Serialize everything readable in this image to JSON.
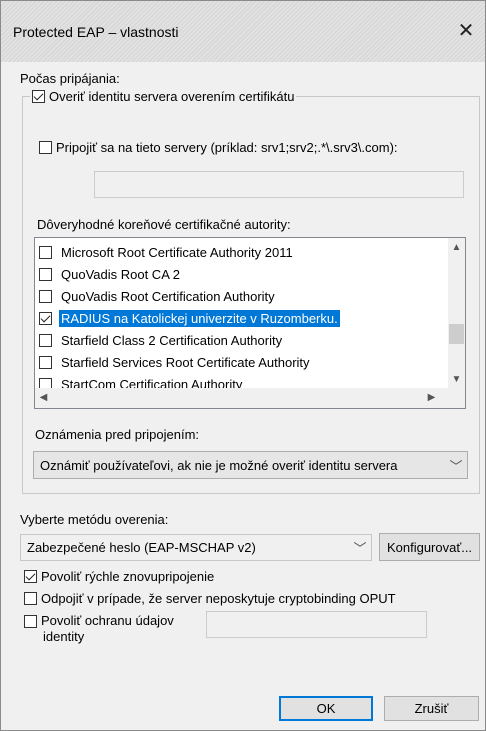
{
  "window": {
    "title": "Protected EAP – vlastnosti"
  },
  "connecting": {
    "label": "Počas pripájania:",
    "verify_identity": {
      "label": "Overiť identitu servera overením certifikátu",
      "checked": true
    },
    "connect_servers": {
      "label": "Pripojiť sa na tieto servery (príklad: srv1;srv2;.*\\.srv3\\.com):",
      "checked": false,
      "value": ""
    },
    "trusted_roots_label": "Dôveryhodné koreňové certifikačné autority:",
    "trusted_roots": [
      {
        "label": "Microsoft Root Certificate Authority 2011",
        "checked": false,
        "selected": false
      },
      {
        "label": "QuoVadis Root CA 2",
        "checked": false,
        "selected": false
      },
      {
        "label": "QuoVadis Root Certification Authority",
        "checked": false,
        "selected": false
      },
      {
        "label": "RADIUS na Katolickej univerzite v Ruzomberku.",
        "checked": true,
        "selected": true
      },
      {
        "label": "Starfield Class 2 Certification Authority",
        "checked": false,
        "selected": false
      },
      {
        "label": "Starfield Services Root Certificate Authority",
        "checked": false,
        "selected": false
      },
      {
        "label": "StartCom Certification Authority",
        "checked": false,
        "selected": false
      }
    ],
    "notifications_label": "Oznámenia pred pripojením:",
    "notifications_value": "Oznámiť používateľovi, ak nie je možné overiť identitu servera"
  },
  "auth": {
    "label": "Vyberte metódu overenia:",
    "method_value": "Zabezpečené heslo (EAP-MSCHAP v2)",
    "configure_label": "Konfigurovať..."
  },
  "options": {
    "fast_reconnect": {
      "label": "Povoliť rýchle znovupripojenie",
      "checked": true
    },
    "disconnect_cryptobinding": {
      "label": "Odpojiť v prípade, že server neposkytuje cryptobinding OPUT",
      "checked": false
    },
    "identity_privacy": {
      "label_line1": "Povoliť ochranu údajov",
      "label_line2": "identity",
      "checked": false,
      "value": ""
    }
  },
  "buttons": {
    "ok": "OK",
    "cancel": "Zrušiť"
  },
  "icons": {
    "close": "close-icon",
    "scroll_up": "scroll-up-icon",
    "scroll_down": "scroll-down-icon",
    "scroll_left": "scroll-left-icon",
    "scroll_right": "scroll-right-icon",
    "dropdown": "chevron-down-icon"
  },
  "colors": {
    "selection": "#0078d7",
    "default_button_border": "#0078d7"
  }
}
